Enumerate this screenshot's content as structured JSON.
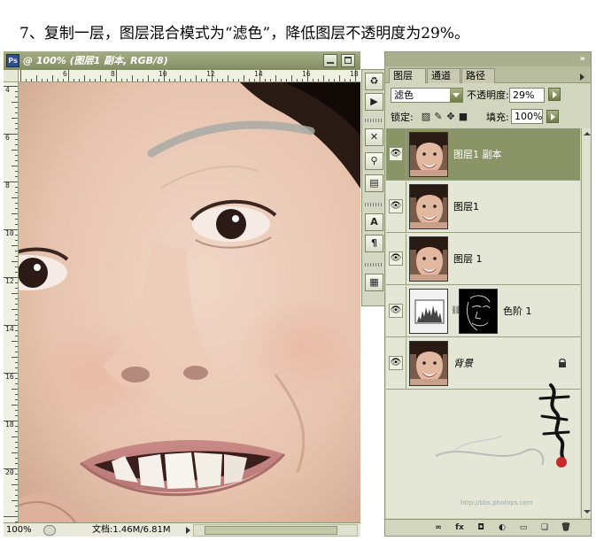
{
  "caption": "7、复制一层，图层混合模式为“滤色”，降低图层不透明度为29%。",
  "document": {
    "title": "@ 100% (图层1 副本, RGB/8)",
    "ps_icon": "Ps",
    "ruler_h_labels": [
      "6",
      "8",
      "10",
      "12",
      "14",
      "16",
      "18",
      "20"
    ],
    "ruler_v_labels": [
      "4",
      "6",
      "8",
      "10",
      "12",
      "14",
      "16",
      "18",
      "20"
    ],
    "status_zoom": "100%",
    "status_doc": "文档:1.46M/6.81M"
  },
  "toolstrip": {
    "buttons": [
      {
        "icon": "history-brush-icon",
        "glyph": "♻"
      },
      {
        "icon": "play-action-icon",
        "glyph": "▶"
      },
      {
        "icon": "tools-icon",
        "glyph": "✕"
      },
      {
        "icon": "clone-source-icon",
        "glyph": "⚲"
      },
      {
        "icon": "layer-comps-icon",
        "glyph": "▤"
      },
      {
        "icon": "character-icon",
        "glyph": "A"
      },
      {
        "icon": "paragraph-icon",
        "glyph": "¶"
      },
      {
        "icon": "notes-icon",
        "glyph": "▦"
      }
    ]
  },
  "panel": {
    "tabs": [
      {
        "label": "图层",
        "closable": true,
        "active": true
      },
      {
        "label": "通道",
        "closable": false,
        "active": false
      },
      {
        "label": "路径",
        "closable": false,
        "active": false
      }
    ],
    "blend_mode": "滤色",
    "opacity_label": "不透明度:",
    "opacity_value": "29%",
    "lock_label": "锁定:",
    "fill_label": "填充:",
    "fill_value": "100%",
    "layers": [
      {
        "name": "图层1 副本",
        "selected": true,
        "type": "photo"
      },
      {
        "name": "图层1",
        "selected": false,
        "type": "photo"
      },
      {
        "name": "图层 1",
        "selected": false,
        "type": "photo"
      },
      {
        "name": "色阶 1",
        "selected": false,
        "type": "adjustment"
      },
      {
        "name": "背景",
        "selected": false,
        "type": "background",
        "locked": true
      }
    ],
    "footer_buttons": [
      {
        "icon": "link-layers-icon",
        "glyph": "∞"
      },
      {
        "icon": "layer-style-icon",
        "glyph": "fx"
      },
      {
        "icon": "layer-mask-icon",
        "glyph": "◘"
      },
      {
        "icon": "adjustment-layer-icon",
        "glyph": "◐"
      },
      {
        "icon": "new-group-icon",
        "glyph": "▭"
      },
      {
        "icon": "new-layer-icon",
        "glyph": "❏"
      },
      {
        "icon": "delete-layer-icon",
        "glyph": "🗑"
      }
    ]
  },
  "watermark_url": "http://bbs.photops.com"
}
